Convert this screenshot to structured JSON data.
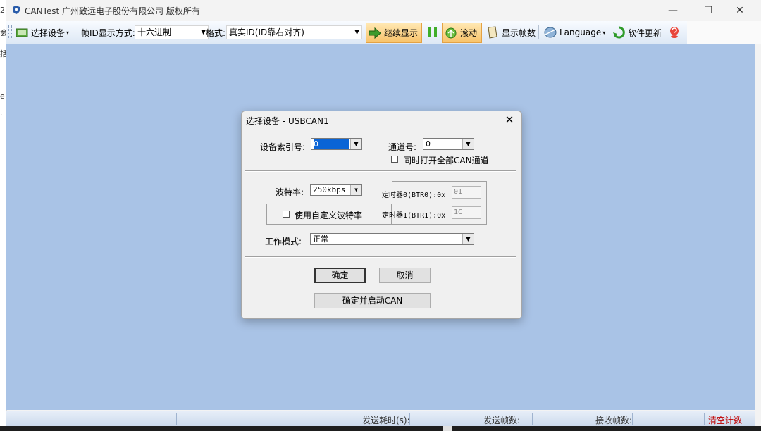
{
  "window": {
    "title": "CANTest    广州致远电子股份有限公司 版权所有",
    "minimize": "—",
    "maximize": "☐",
    "close": "✕"
  },
  "left_edge_chars": [
    "2",
    "会",
    "括",
    "e",
    "."
  ],
  "toolbar": {
    "select_device": "选择设备",
    "frame_id_mode_label": "帧ID显示方式:",
    "frame_id_mode_value": "十六进制",
    "format_label": "格式:",
    "format_value": "真实ID(ID靠右对齐)",
    "continue_display": "继续显示",
    "scroll": "滚动",
    "show_frame_count": "显示帧数",
    "language": "Language",
    "software_update": "软件更新",
    "dropdown_caret": "▾",
    "combo_arrow": "▼"
  },
  "statusbar": {
    "send_time": "发送耗时(s):",
    "send_frames": "发送帧数:",
    "recv_frames": "接收帧数:",
    "clear_count": "清空计数"
  },
  "dialog": {
    "title": "选择设备 - USBCAN1",
    "close": "✕",
    "device_index_label": "设备索引号:",
    "device_index_value": "0",
    "channel_label": "通道号:",
    "channel_value": "0",
    "open_all_label": "同时打开全部CAN通道",
    "baud_label": "波特率:",
    "baud_value": "250kbps",
    "custom_baud_label": "使用自定义波特率",
    "timer0_label": "定时器0(BTR0):0x",
    "timer0_value": "01",
    "timer1_label": "定时器1(BTR1):0x",
    "timer1_value": "1C",
    "mode_label": "工作模式:",
    "mode_value": "正常",
    "ok": "确定",
    "cancel": "取消",
    "ok_start": "确定并启动CAN",
    "arrow": "▼"
  },
  "colors": {
    "workspace": "#a9c3e6",
    "toolbar_active": "#f8c36a",
    "clear_count": "#c00000",
    "selection": "#0a64d6"
  }
}
